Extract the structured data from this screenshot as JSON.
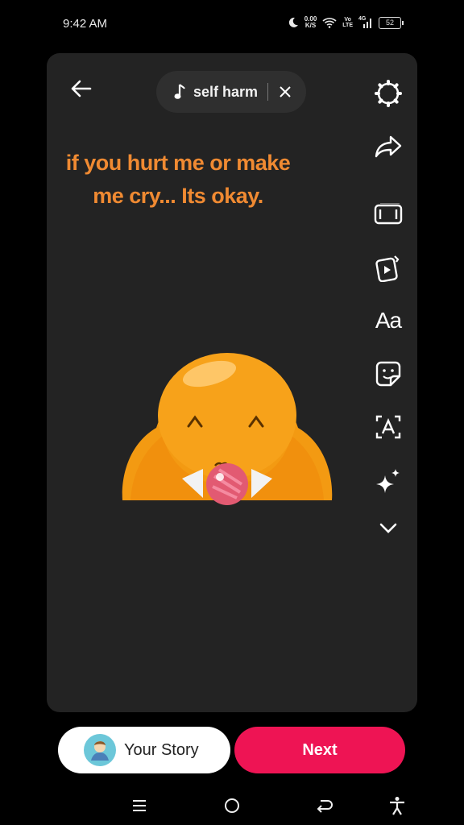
{
  "status_bar": {
    "time": "9:42 AM",
    "speed_value": "0.00",
    "speed_unit": "K/S",
    "volte_top": "Vo",
    "volte_bottom": "LTE",
    "network": "4G",
    "battery": "52",
    "icons": [
      "moon-icon",
      "wifi-icon",
      "signal-icon",
      "battery-icon"
    ]
  },
  "editor": {
    "music": {
      "title": "self harm"
    },
    "caption": "if you hurt me or make me cry... Its okay.",
    "caption_color": "#f08a32",
    "tools": [
      "settings-gear-icon",
      "share-arrow-icon",
      "aspect-ratio-icon",
      "templates-icon",
      "text-tool-icon",
      "sticker-icon",
      "auto-captions-icon",
      "effects-sparkle-icon",
      "more-chevron-icon"
    ],
    "text_tool_label": "Aa"
  },
  "actions": {
    "your_story_label": "Your Story",
    "next_label": "Next",
    "next_color": "#ee1454"
  },
  "nav": [
    "menu-icon",
    "home-icon",
    "back-icon",
    "accessibility-icon"
  ]
}
